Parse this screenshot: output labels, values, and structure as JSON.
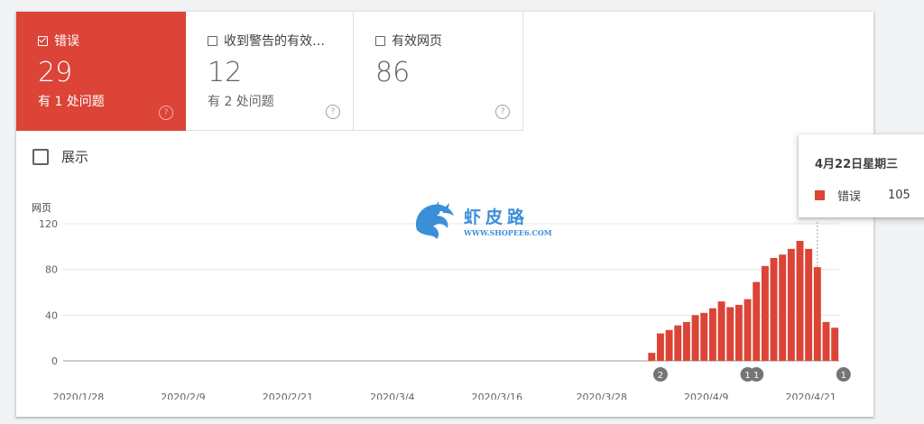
{
  "tiles": [
    {
      "label": "错误",
      "count": "29",
      "sub": "有 1 处问题",
      "checked": true
    },
    {
      "label": "收到警告的有效…",
      "count": "12",
      "sub": "有 2 处问题",
      "checked": false
    },
    {
      "label": "有效网页",
      "count": "86",
      "sub": "",
      "checked": false
    }
  ],
  "help_glyph": "?",
  "show_label": "展示",
  "tooltip": {
    "date": "4月22日星期三",
    "series": "错误",
    "value": "105"
  },
  "watermark": {
    "cn": "虾皮路",
    "en": "WWW.SHOPEE6.COM"
  },
  "colors": {
    "error": "#db4437",
    "annotation": "#757575"
  },
  "chart_data": {
    "type": "bar",
    "ylabel": "网页",
    "ylim": [
      0,
      120
    ],
    "yticks": [
      0,
      40,
      80,
      120
    ],
    "x_tick_labels": [
      "2020/1/28",
      "2020/2/9",
      "2020/2/21",
      "2020/3/4",
      "2020/3/16",
      "2020/3/28",
      "2020/4/9",
      "2020/4/21"
    ],
    "x_tick_index": [
      0,
      12,
      24,
      36,
      48,
      60,
      72,
      84
    ],
    "series": [
      {
        "name": "错误",
        "color": "#db4437",
        "values": [
          0,
          0,
          0,
          0,
          0,
          0,
          0,
          0,
          0,
          0,
          0,
          0,
          0,
          0,
          0,
          0,
          0,
          0,
          0,
          0,
          0,
          0,
          0,
          0,
          0,
          0,
          0,
          0,
          0,
          0,
          0,
          0,
          0,
          0,
          0,
          0,
          0,
          0,
          0,
          0,
          0,
          0,
          0,
          0,
          0,
          0,
          0,
          0,
          0,
          0,
          0,
          0,
          0,
          0,
          0,
          0,
          0,
          0,
          0,
          0,
          0,
          0,
          0,
          0,
          0,
          0,
          0,
          7,
          24,
          27,
          31,
          34,
          40,
          42,
          46,
          52,
          47,
          49,
          54,
          69,
          83,
          90,
          93,
          98,
          105,
          98,
          82,
          34,
          29
        ]
      }
    ],
    "annotations": [
      {
        "index": 68,
        "label": "2"
      },
      {
        "index": 78,
        "label": "1"
      },
      {
        "index": 79,
        "label": "1"
      },
      {
        "index": 89,
        "label": "1"
      }
    ],
    "hover_index": 86,
    "grid": true
  }
}
